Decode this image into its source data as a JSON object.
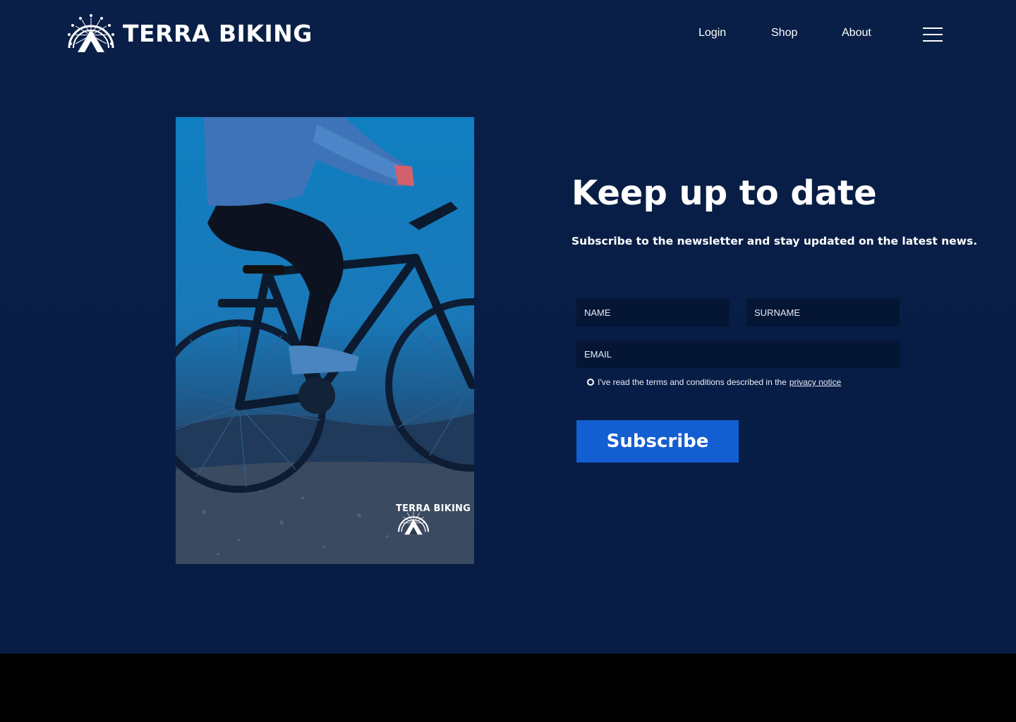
{
  "header": {
    "brand_name": "TERRA BIKING",
    "logo_icon": "bike-wheel-mountain-logo",
    "nav": {
      "login": "Login",
      "shop": "Shop",
      "about": "About"
    },
    "menu_icon": "hamburger-menu-icon"
  },
  "photo": {
    "description_icon": "cyclist-mountain-bike-photo",
    "brand_name": "TERRA BIKING"
  },
  "newsletter": {
    "headline": "Keep up to date",
    "subtitle": "Subscribe to the newsletter and stay updated on the latest news.",
    "name_placeholder": "NAME",
    "surname_placeholder": "SURNAME",
    "email_placeholder": "EMAIL",
    "terms_text": "I've read the terms and conditions described in the",
    "privacy_link": "privacy notice",
    "subscribe_label": "Subscribe"
  },
  "colors": {
    "background": "#0a1f47",
    "field_background": "#051634",
    "button": "#135ed0",
    "footer": "#000000"
  }
}
